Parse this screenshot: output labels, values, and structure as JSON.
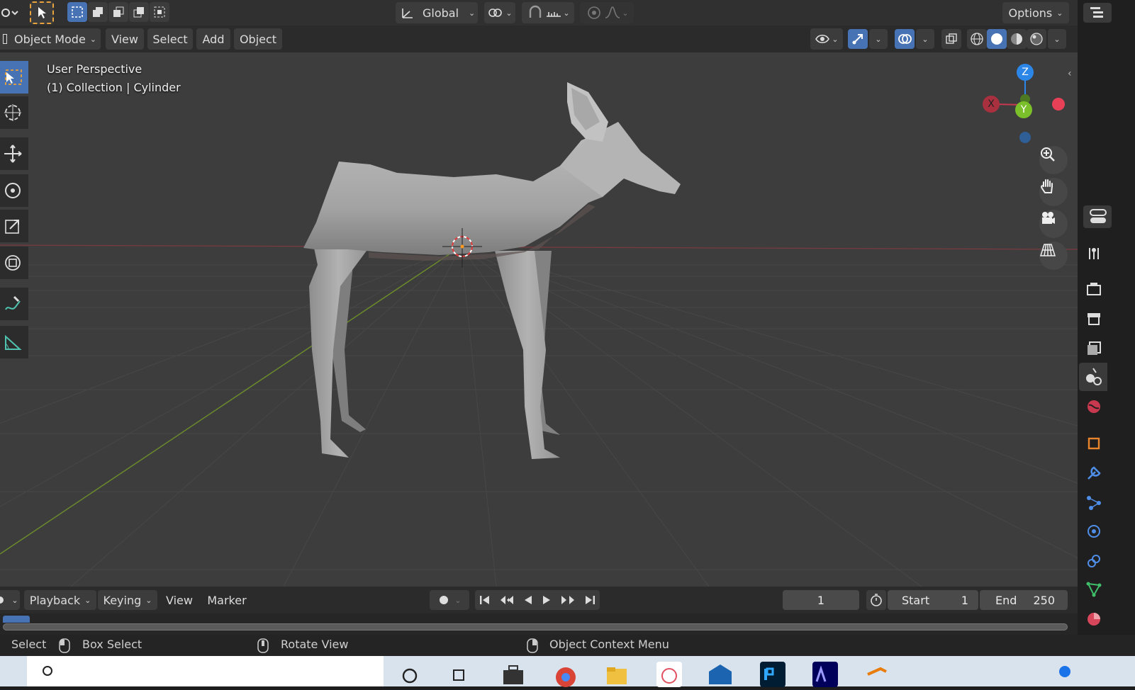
{
  "header": {
    "transform_orientation": "Global",
    "options_label": "Options"
  },
  "menu": {
    "mode": "Object Mode",
    "view": "View",
    "select": "Select",
    "add": "Add",
    "object": "Object"
  },
  "viewport": {
    "perspective_label": "User Perspective",
    "collection_label": "(1) Collection | Cylinder",
    "axes": {
      "x": "X",
      "y": "Y",
      "z": "Z"
    }
  },
  "timeline": {
    "playback": "Playback",
    "keying": "Keying",
    "view": "View",
    "marker": "Marker",
    "current_frame": "1",
    "start_label": "Start",
    "start_value": "1",
    "end_label": "End",
    "end_value": "250"
  },
  "status": {
    "select": "Select",
    "box_select": "Box Select",
    "rotate_view": "Rotate View",
    "context_menu": "Object Context Menu"
  },
  "colors": {
    "accent": "#4772b3",
    "x_axis": "#c8394f",
    "y_axis": "#6ea02c",
    "z_axis": "#2b86e8"
  }
}
